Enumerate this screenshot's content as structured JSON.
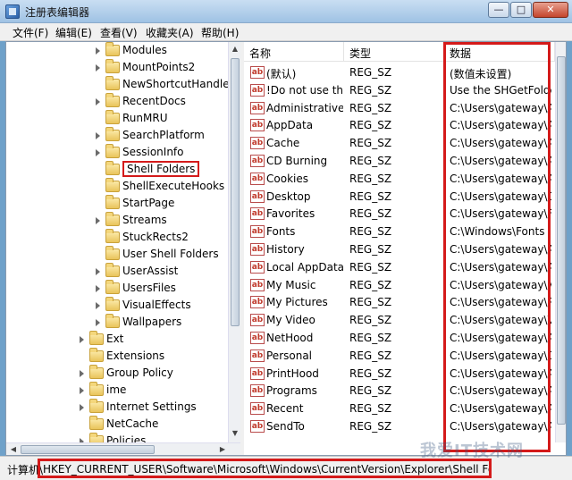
{
  "window": {
    "title": "注册表编辑器",
    "buttons": {
      "minimize": "—",
      "maximize": "□",
      "close": "✕"
    }
  },
  "menu": [
    "文件(F)",
    "编辑(E)",
    "查看(V)",
    "收藏夹(A)",
    "帮助(H)"
  ],
  "tree": {
    "items": [
      {
        "label": "Modules",
        "level": 2,
        "expandable": true
      },
      {
        "label": "MountPoints2",
        "level": 2,
        "expandable": true
      },
      {
        "label": "NewShortcutHandlers",
        "level": 2,
        "expandable": false
      },
      {
        "label": "RecentDocs",
        "level": 2,
        "expandable": true
      },
      {
        "label": "RunMRU",
        "level": 2,
        "expandable": false
      },
      {
        "label": "SearchPlatform",
        "level": 2,
        "expandable": true
      },
      {
        "label": "SessionInfo",
        "level": 2,
        "expandable": true
      },
      {
        "label": "Shell Folders",
        "level": 2,
        "expandable": false,
        "selected": true
      },
      {
        "label": "ShellExecuteHooks",
        "level": 2,
        "expandable": false
      },
      {
        "label": "StartPage",
        "level": 2,
        "expandable": false
      },
      {
        "label": "Streams",
        "level": 2,
        "expandable": true
      },
      {
        "label": "StuckRects2",
        "level": 2,
        "expandable": false
      },
      {
        "label": "User Shell Folders",
        "level": 2,
        "expandable": false
      },
      {
        "label": "UserAssist",
        "level": 2,
        "expandable": true
      },
      {
        "label": "UsersFiles",
        "level": 2,
        "expandable": true
      },
      {
        "label": "VisualEffects",
        "level": 2,
        "expandable": true
      },
      {
        "label": "Wallpapers",
        "level": 2,
        "expandable": true
      },
      {
        "label": "Ext",
        "level": 1,
        "expandable": true
      },
      {
        "label": "Extensions",
        "level": 1,
        "expandable": false
      },
      {
        "label": "Group Policy",
        "level": 1,
        "expandable": true
      },
      {
        "label": "ime",
        "level": 1,
        "expandable": true
      },
      {
        "label": "Internet Settings",
        "level": 1,
        "expandable": true
      },
      {
        "label": "NetCache",
        "level": 1,
        "expandable": false
      },
      {
        "label": "Policies",
        "level": 1,
        "expandable": true
      }
    ]
  },
  "values": {
    "columns": {
      "name": "名称",
      "type": "类型",
      "data": "数据"
    },
    "rows": [
      {
        "name": "(默认)",
        "type": "REG_SZ",
        "data": "(数值未设置)"
      },
      {
        "name": "!Do not use this...",
        "type": "REG_SZ",
        "data": "Use the SHGetFolderPath"
      },
      {
        "name": "Administrative ...",
        "type": "REG_SZ",
        "data": "C:\\Users\\gateway\\AppData"
      },
      {
        "name": "AppData",
        "type": "REG_SZ",
        "data": "C:\\Users\\gateway\\AppData"
      },
      {
        "name": "Cache",
        "type": "REG_SZ",
        "data": "C:\\Users\\gateway\\AppData"
      },
      {
        "name": "CD Burning",
        "type": "REG_SZ",
        "data": "C:\\Users\\gateway\\AppData"
      },
      {
        "name": "Cookies",
        "type": "REG_SZ",
        "data": "C:\\Users\\gateway\\AppData"
      },
      {
        "name": "Desktop",
        "type": "REG_SZ",
        "data": "C:\\Users\\gateway\\Desktop"
      },
      {
        "name": "Favorites",
        "type": "REG_SZ",
        "data": "C:\\Users\\gateway\\Favorites"
      },
      {
        "name": "Fonts",
        "type": "REG_SZ",
        "data": "C:\\Windows\\Fonts"
      },
      {
        "name": "History",
        "type": "REG_SZ",
        "data": "C:\\Users\\gateway\\AppData"
      },
      {
        "name": "Local AppData",
        "type": "REG_SZ",
        "data": "C:\\Users\\gateway\\AppData"
      },
      {
        "name": "My Music",
        "type": "REG_SZ",
        "data": "C:\\Users\\gateway\\Music"
      },
      {
        "name": "My Pictures",
        "type": "REG_SZ",
        "data": "C:\\Users\\gateway\\Pictures"
      },
      {
        "name": "My Video",
        "type": "REG_SZ",
        "data": "C:\\Users\\gateway\\Videos"
      },
      {
        "name": "NetHood",
        "type": "REG_SZ",
        "data": "C:\\Users\\gateway\\AppData"
      },
      {
        "name": "Personal",
        "type": "REG_SZ",
        "data": "C:\\Users\\gateway\\Documents"
      },
      {
        "name": "PrintHood",
        "type": "REG_SZ",
        "data": "C:\\Users\\gateway\\AppData"
      },
      {
        "name": "Programs",
        "type": "REG_SZ",
        "data": "C:\\Users\\gateway\\AppData"
      },
      {
        "name": "Recent",
        "type": "REG_SZ",
        "data": "C:\\Users\\gateway\\AppData"
      },
      {
        "name": "SendTo",
        "type": "REG_SZ",
        "data": "C:\\Users\\gateway\\AppData"
      }
    ]
  },
  "status": {
    "prefix": "计算机\\",
    "path": "HKEY_CURRENT_USER\\Software\\Microsoft\\Windows\\CurrentVersion\\Explorer\\Shell Folders"
  },
  "watermark": "我爱IT技术网",
  "colors": {
    "highlight": "#d41a1a",
    "titlebar": "#9fc2e4"
  }
}
